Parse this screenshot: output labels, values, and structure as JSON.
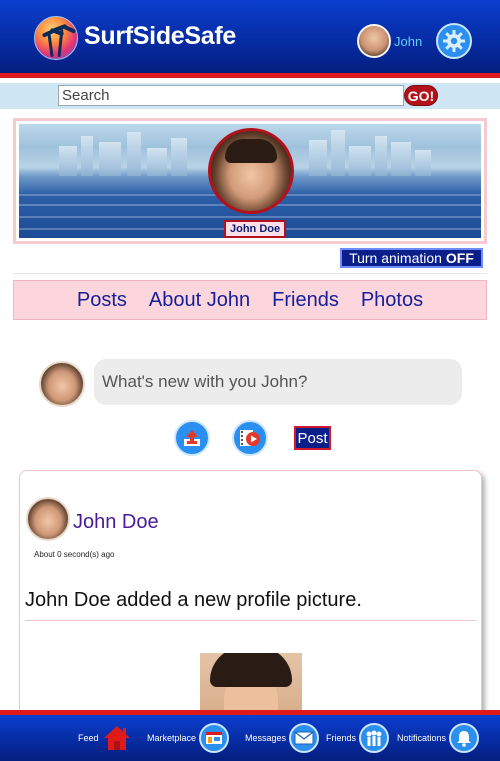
{
  "header": {
    "brand": "SurfSideSafe",
    "user_name": "John"
  },
  "search": {
    "placeholder": "Search",
    "go_label": "GO!"
  },
  "profile": {
    "name_tag": "John Doe",
    "animation_button": "Turn animation",
    "animation_state": "OFF"
  },
  "tabs": [
    "Posts",
    "About John",
    "Friends",
    "Photos"
  ],
  "composer": {
    "placeholder": "What's new with you John?",
    "post_label": "Post",
    "upload_icon": "upload-icon",
    "video_icon": "video-icon"
  },
  "feed": {
    "post": {
      "author": "John Doe",
      "time": "About 0 second(s) ago",
      "text": "John Doe added a new profile picture."
    }
  },
  "bottom_nav": {
    "items": [
      {
        "label": "Feed",
        "icon": "home-icon"
      },
      {
        "label": "Marketplace",
        "icon": "marketplace-icon"
      },
      {
        "label": "Messages",
        "icon": "mail-icon"
      },
      {
        "label": "Friends",
        "icon": "friends-icon"
      },
      {
        "label": "Notifications",
        "icon": "bell-icon"
      }
    ]
  },
  "colors": {
    "header_blue": "#062aa0",
    "accent_red": "#e01a1a",
    "tab_pink": "#fdd5dc",
    "link_blue": "#15209a"
  }
}
